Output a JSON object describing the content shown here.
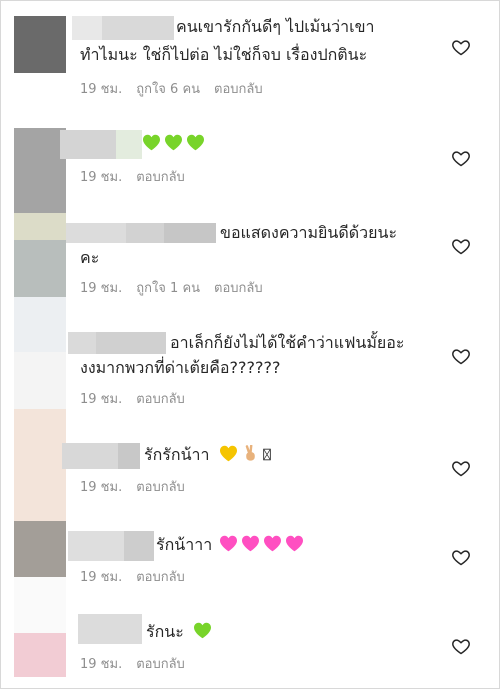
{
  "comments": [
    {
      "text_line1": "คนเขารักกันดีๆ  ไปเม้นว่าเขา",
      "text_line2": "ทำไมนะ ใช่ก็ไปต่อ ไม่ใช่ก็จบ เรื่องปกตินะ",
      "time": "19 ชม.",
      "likes": "ถูกใจ 6 คน",
      "reply": "ตอบกลับ",
      "like_icon": "heart-outline-icon"
    },
    {
      "text_line1": "",
      "emojis": [
        "green-heart-emoji",
        "green-heart-emoji",
        "green-heart-emoji"
      ],
      "time": "19 ชม.",
      "reply": "ตอบกลับ",
      "like_icon": "heart-outline-icon"
    },
    {
      "text_line1": "ขอแสดงความยินดีด้วยนะ",
      "text_line2": "คะ",
      "time": "19 ชม.",
      "likes": "ถูกใจ 1 คน",
      "reply": "ตอบกลับ",
      "like_icon": "heart-outline-icon"
    },
    {
      "text_line1": "อาเล็กก็ยังไม่ได้ใช้คำว่าแฟนมั้ยอะ",
      "text_line2": "งงมากพวกที่ด่าเต้ยคือ??????",
      "time": "19 ชม.",
      "reply": "ตอบกลับ",
      "like_icon": "heart-outline-icon"
    },
    {
      "text_line1": "รักรักน้าา",
      "emojis": [
        "yellow-heart-emoji",
        "victory-hand-emoji",
        "missing-glyph-box"
      ],
      "time": "19 ชม.",
      "reply": "ตอบกลับ",
      "like_icon": "heart-outline-icon"
    },
    {
      "text_line1": "รักน้าาา",
      "emojis": [
        "pink-heart-emoji",
        "pink-heart-emoji",
        "pink-heart-emoji",
        "pink-heart-emoji"
      ],
      "time": "19 ชม.",
      "reply": "ตอบกลับ",
      "like_icon": "heart-outline-icon"
    },
    {
      "text_line1": "รักนะ",
      "emojis": [
        "green-heart-emoji"
      ],
      "time": "19 ชม.",
      "reply": "ตอบกลับ",
      "like_icon": "heart-outline-icon"
    }
  ],
  "colors": {
    "text": "#262626",
    "meta": "#8e8e8e",
    "green_heart": "#78d42a",
    "yellow_heart": "#f5c400",
    "pink_heart": "#ff4fc1"
  }
}
